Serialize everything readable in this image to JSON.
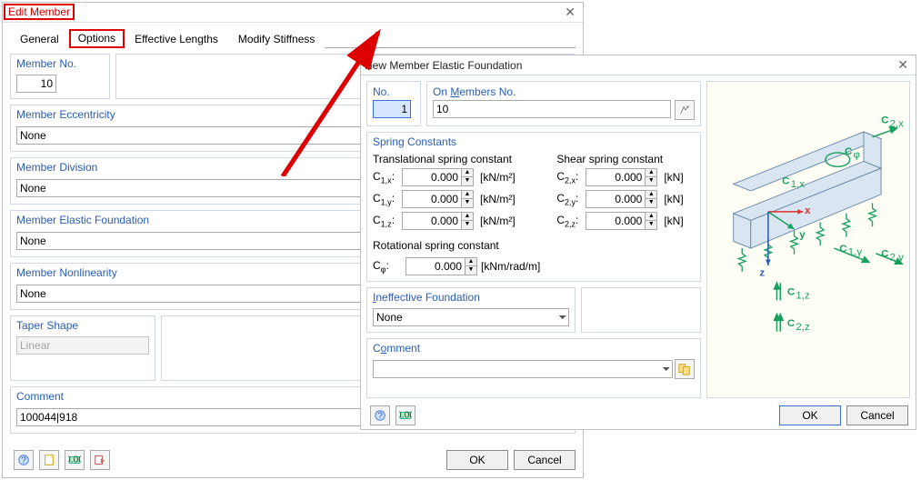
{
  "main": {
    "title": "Edit Member",
    "tabs": {
      "general": "General",
      "options": "Options",
      "efflen": "Effective Lengths",
      "modstiff": "Modify Stiffness"
    },
    "memberNo": {
      "title": "Member No.",
      "value": "10"
    },
    "ecc": {
      "title": "Member Eccentricity",
      "value": "None"
    },
    "div": {
      "title": "Member Division",
      "value": "None"
    },
    "found": {
      "title": "Member Elastic Foundation",
      "value": "None"
    },
    "nonlin": {
      "title": "Member Nonlinearity",
      "value": "None"
    },
    "taper": {
      "title": "Taper Shape",
      "value": "Linear"
    },
    "comment": {
      "title": "Comment",
      "value": "100044|918"
    },
    "ok": "OK",
    "cancel": "Cancel"
  },
  "d2": {
    "title": "New Member Elastic Foundation",
    "no_label": "No.",
    "no_value": "1",
    "onmem_label": "On Members No.",
    "onmem_value": "10",
    "springs_title": "Spring Constants",
    "trans_hdr": "Translational spring constant",
    "shear_hdr": "Shear spring constant",
    "rot_hdr": "Rotational spring constant",
    "c1x": "C1,x:",
    "c1y": "C1,y:",
    "c1z": "C1,z:",
    "c2x": "C2,x:",
    "c2y": "C2,y:",
    "c2z": "C2,z:",
    "cphi": "Cφ:",
    "zero": "0.000",
    "u_knm2": "[kN/m²]",
    "u_kn": "[kN]",
    "u_rot": "[kNm/rad/m]",
    "ineff_title": "Ineffective Foundation",
    "ineff_value": "None",
    "comment_title": "Comment",
    "comment_value": "",
    "ok": "OK",
    "cancel": "Cancel",
    "diag": {
      "c2x": "C2,x",
      "cphi": "Cφ",
      "c1x": "C1,x",
      "x": "x",
      "y": "y",
      "z": "z",
      "c1y": "C1,y",
      "c2y": "C2,y",
      "c1z": "C1,z",
      "c2z": "C2,z"
    }
  }
}
